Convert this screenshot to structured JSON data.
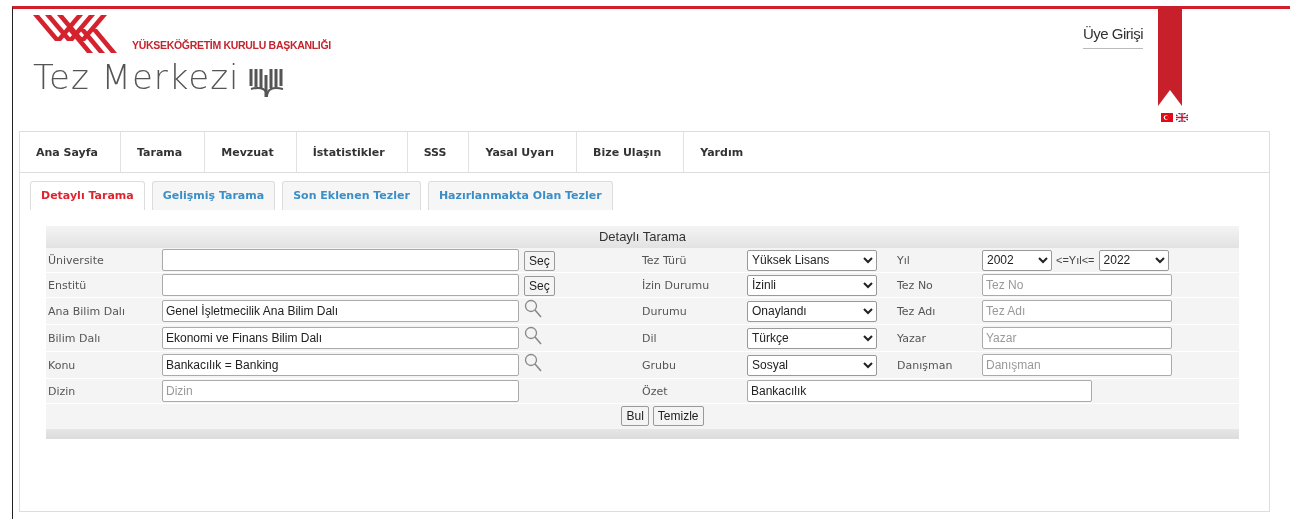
{
  "header": {
    "org_name": "YÜKSEKÖĞRETİM KURULU BAŞKANLIĞI",
    "site_title": "Tez Merkezi",
    "login": "Üye Girişi"
  },
  "nav": [
    {
      "label": "Ana Sayfa"
    },
    {
      "label": "Tarama"
    },
    {
      "label": "Mevzuat"
    },
    {
      "label": "İstatistikler"
    },
    {
      "label": "SSS"
    },
    {
      "label": "Yasal Uyarı"
    },
    {
      "label": "Bize Ulaşın"
    },
    {
      "label": "Yardım"
    }
  ],
  "tabs": [
    {
      "label": "Detaylı Tarama",
      "selected": true
    },
    {
      "label": "Gelişmiş Tarama",
      "selected": false
    },
    {
      "label": "Son Eklenen Tezler",
      "selected": false
    },
    {
      "label": "Hazırlanmakta Olan Tezler",
      "selected": false
    }
  ],
  "form": {
    "title": "Detaylı Tarama",
    "left": [
      {
        "label": "Üniversite",
        "kind": "button",
        "action_label": "Seç"
      },
      {
        "label": "Enstitü",
        "kind": "button",
        "action_label": "Seç"
      },
      {
        "label": "Ana Bilim Dalı",
        "value": "Genel İşletmecilik Ana Bilim Dalı",
        "kind": "search"
      },
      {
        "label": "Bilim Dalı",
        "value": "Ekonomi ve Finans Bilim Dalı",
        "kind": "search"
      },
      {
        "label": "Konu",
        "value": "Bankacılık = Banking",
        "kind": "search"
      },
      {
        "label": "Dizin",
        "placeholder": "Dizin"
      }
    ],
    "middle": [
      {
        "label": "Tez Türü",
        "kind": "select",
        "value": "Yüksek Lisans"
      },
      {
        "label": "İzin Durumu",
        "kind": "select",
        "value": "İzinli"
      },
      {
        "label": "Durumu",
        "kind": "select",
        "value": "Onaylandı"
      },
      {
        "label": "Dil",
        "kind": "select",
        "value": "Türkçe"
      },
      {
        "label": "Grubu",
        "kind": "select",
        "value": "Sosyal"
      },
      {
        "label": "Özet",
        "kind": "wide_text",
        "value": "Bankacılık"
      }
    ],
    "right": [
      {
        "label": "Yıl",
        "kind": "range",
        "from": "2002",
        "separator": "<=Yıl<=",
        "to": "2022"
      },
      {
        "label": "Tez No",
        "kind": "text",
        "placeholder": "Tez No"
      },
      {
        "label": "Tez Adı",
        "kind": "text",
        "placeholder": "Tez Adı"
      },
      {
        "label": "Yazar",
        "kind": "text",
        "placeholder": "Yazar"
      },
      {
        "label": "Danışman",
        "kind": "text",
        "placeholder": "Danışman"
      }
    ],
    "buttons": [
      {
        "label": "Bul"
      },
      {
        "label": "Temizle"
      }
    ]
  }
}
